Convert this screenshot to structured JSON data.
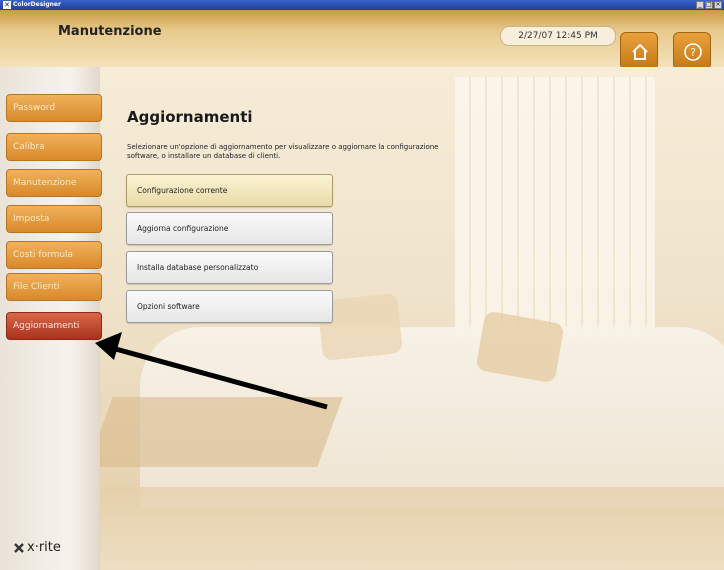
{
  "window": {
    "title": "ColorDesigner",
    "controls": [
      "_",
      "□",
      "×"
    ]
  },
  "header": {
    "title": "Manutenzione",
    "datetime": "2/27/07 12:45 PM",
    "home_icon": "home-icon",
    "help_icon": "help-icon"
  },
  "sidebar": {
    "items": [
      {
        "label": "Password"
      },
      {
        "label": "Calibra"
      },
      {
        "label": "Manutenzione"
      },
      {
        "label": "Imposta"
      },
      {
        "label": "Costi formula"
      },
      {
        "label": "File Clienti"
      },
      {
        "label": "Aggiornamenti",
        "active": true
      }
    ],
    "logo_text": "x·rite"
  },
  "content": {
    "title": "Aggiornamenti",
    "description": "Selezionare un'opzione di aggiornamento per visualizzare o aggiornare la configurazione software, o installare un database di clienti.",
    "options": [
      {
        "label": "Configurazione corrente"
      },
      {
        "label": "Aggiorna configurazione"
      },
      {
        "label": "Installa database personalizzato"
      },
      {
        "label": "Opzioni software"
      }
    ]
  },
  "colors": {
    "nav_orange": "#e09a3a",
    "nav_active": "#b8402a",
    "header_gold": "#d9ad5a"
  }
}
